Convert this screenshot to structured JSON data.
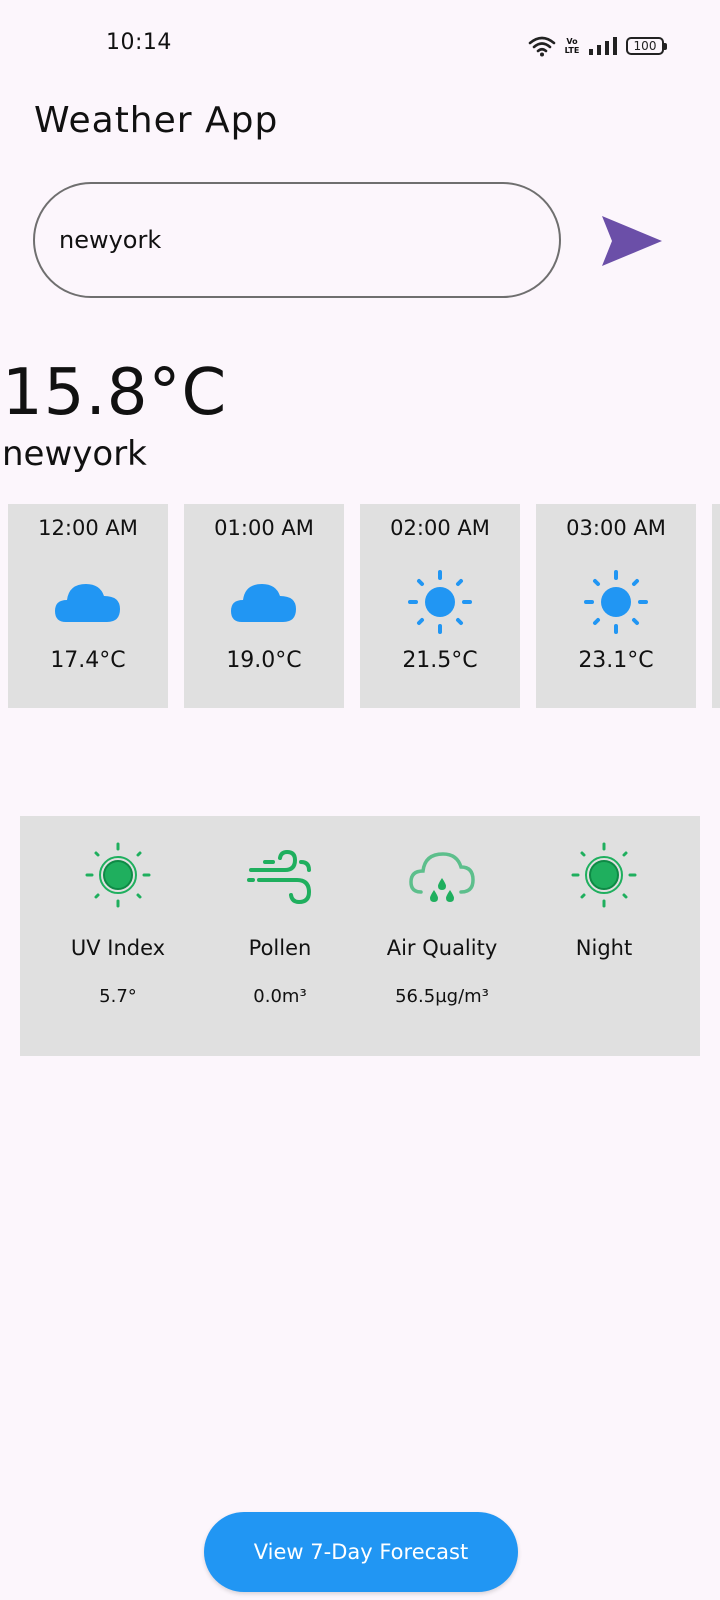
{
  "status_bar": {
    "time": "10:14",
    "volte_line1": "Vo",
    "volte_line2": "LTE",
    "battery": "100"
  },
  "app": {
    "title": "Weather App"
  },
  "search": {
    "value": "newyork",
    "send_icon": "send-icon",
    "accent": "#6B4FA8"
  },
  "current": {
    "temperature": "15.8°C",
    "city": "newyork"
  },
  "hourly": [
    {
      "time": "12:00 AM",
      "icon": "cloud-icon",
      "temp": "17.4°C"
    },
    {
      "time": "01:00 AM",
      "icon": "cloud-icon",
      "temp": "19.0°C"
    },
    {
      "time": "02:00 AM",
      "icon": "sun-icon",
      "temp": "21.5°C"
    },
    {
      "time": "03:00 AM",
      "icon": "sun-icon",
      "temp": "23.1°C"
    }
  ],
  "details": [
    {
      "label": "UV Index",
      "value": "5.7°",
      "icon": "uv-sun-icon"
    },
    {
      "label": "Pollen",
      "value": "0.0m³",
      "icon": "wind-icon"
    },
    {
      "label": "Air Quality",
      "value": "56.5µg/m³",
      "icon": "cloud-rain-icon"
    },
    {
      "label": "Night",
      "value": "",
      "icon": "night-sun-icon"
    }
  ],
  "colors": {
    "weather_icon": "#2196F3",
    "detail_icon": "#1FAF5E",
    "card_bg": "#E0E0E0",
    "button_bg": "#2196F3"
  },
  "footer": {
    "forecast_button": "View 7-Day Forecast"
  }
}
